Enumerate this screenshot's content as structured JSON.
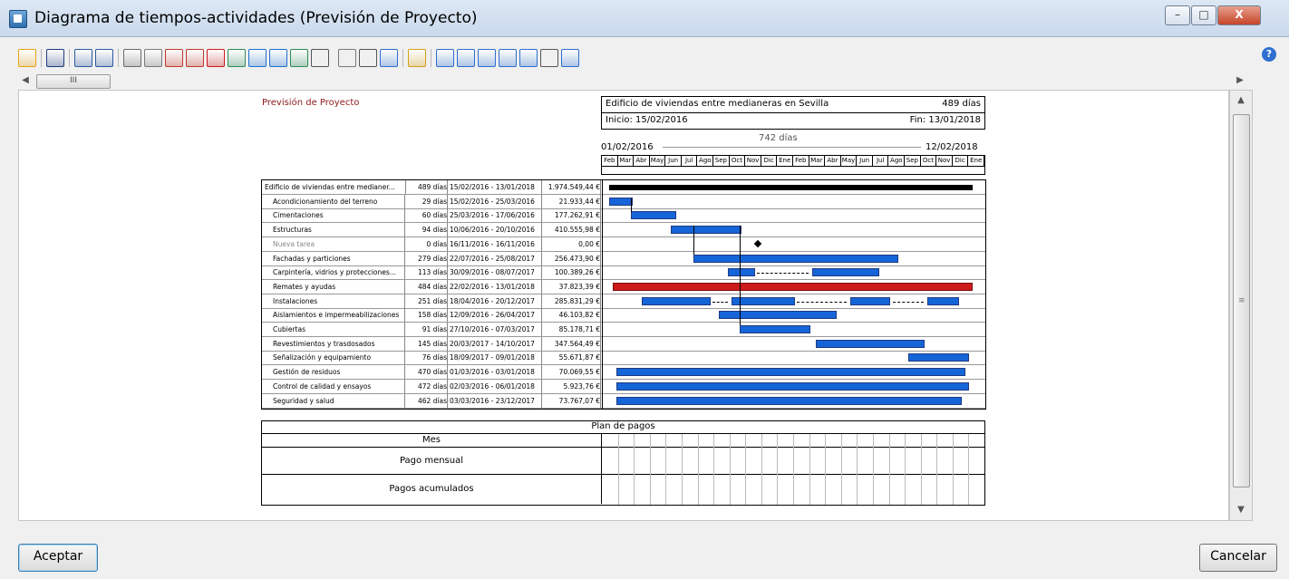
{
  "window": {
    "title": "Diagrama de tiempos-actividades (Previsión de Proyecto)",
    "minimize": "–",
    "maximize": "□",
    "close": "X"
  },
  "toolbar": {
    "icons": [
      "open-folder-icon",
      "save-icon",
      "undo-icon",
      "redo-icon",
      "properties-icon",
      "settings-icon",
      "people-icon",
      "person-icon",
      "delete-icon",
      "gantt-icon",
      "grid-icon",
      "link-icon",
      "chart-icon",
      "view-dropdown-icon",
      "copy-icon",
      "print-icon",
      "export-icon",
      "bar-chart-icon",
      "zoom-icon",
      "zoom-fit-icon",
      "zoom-in-icon",
      "refresh-icon",
      "zoom-out-icon",
      "hand-icon",
      "window-icon"
    ]
  },
  "report": {
    "header_title": "Previsión de Proyecto",
    "project_name": "Edificio de viviendas entre medianeras en Sevilla",
    "project_duration": "489 días",
    "start": "Inicio: 15/02/2016",
    "end": "Fin: 13/01/2018",
    "span": "742 días",
    "span_start": "01/02/2016",
    "span_end": "12/02/2018",
    "months": [
      "Feb",
      "Mar",
      "Abr",
      "May",
      "Jun",
      "Jul",
      "Ago",
      "Sep",
      "Oct",
      "Nov",
      "Dic",
      "Ene",
      "Feb",
      "Mar",
      "Abr",
      "May",
      "Jun",
      "Jul",
      "Ago",
      "Sep",
      "Oct",
      "Nov",
      "Dic",
      "Ene"
    ]
  },
  "tasks": [
    {
      "name": "Edificio de viviendas entre medianer...",
      "dur": "489 días",
      "dates": "15/02/2016 - 13/01/2018",
      "cost": "1.974.549,44 €",
      "start": 0.02,
      "end": 0.965,
      "color": "#000000",
      "summary": true
    },
    {
      "name": "Acondicionamiento del terreno",
      "dur": "29 días",
      "dates": "15/02/2016 - 25/03/2016",
      "cost": "21.933,44 €",
      "start": 0.02,
      "end": 0.076,
      "color": "#1565d8"
    },
    {
      "name": "Cimentaciones",
      "dur": "60 días",
      "dates": "25/03/2016 - 17/06/2016",
      "cost": "177.262,91 €",
      "start": 0.076,
      "end": 0.19,
      "color": "#1565d8"
    },
    {
      "name": "Estructuras",
      "dur": "94 días",
      "dates": "10/06/2016 - 20/10/2016",
      "cost": "410.555,98 €",
      "start": 0.18,
      "end": 0.36,
      "color": "#1565d8"
    },
    {
      "name": "Nueva tarea",
      "dur": "0 días",
      "dates": "16/11/2016 - 16/11/2016",
      "cost": "0,00 €",
      "start": 0.4,
      "end": 0.4,
      "color": "#000000",
      "milestone": true,
      "grey": true
    },
    {
      "name": "Fachadas y particiones",
      "dur": "279 días",
      "dates": "22/07/2016 - 25/08/2017",
      "cost": "256.473,90 €",
      "start": 0.24,
      "end": 0.77,
      "color": "#1565d8"
    },
    {
      "name": "Carpintería, vidrios y protecciones...",
      "dur": "113 días",
      "dates": "30/09/2016 - 08/07/2017",
      "cost": "100.389,26 €",
      "start": 0.33,
      "end": 0.72,
      "color": "#1565d8",
      "split": [
        [
          0.33,
          0.395
        ],
        [
          0.55,
          0.72
        ]
      ]
    },
    {
      "name": "Remates y ayudas",
      "dur": "484 días",
      "dates": "22/02/2016 - 13/01/2018",
      "cost": "37.823,39 €",
      "start": 0.028,
      "end": 0.965,
      "color": "#cc1a1a"
    },
    {
      "name": "Instalaciones",
      "dur": "251 días",
      "dates": "18/04/2016 - 20/12/2017",
      "cost": "285.831,29 €",
      "start": 0.105,
      "end": 0.93,
      "color": "#1565d8",
      "split": [
        [
          0.105,
          0.28
        ],
        [
          0.34,
          0.5
        ],
        [
          0.65,
          0.75
        ],
        [
          0.85,
          0.93
        ]
      ]
    },
    {
      "name": "Aislamientos e impermeabilizaciones",
      "dur": "158 días",
      "dates": "12/09/2016 - 26/04/2017",
      "cost": "46.103,82 €",
      "start": 0.305,
      "end": 0.61,
      "color": "#1565d8"
    },
    {
      "name": "Cubiertas",
      "dur": "91 días",
      "dates": "27/10/2016 - 07/03/2017",
      "cost": "85.178,71 €",
      "start": 0.36,
      "end": 0.54,
      "color": "#1565d8"
    },
    {
      "name": "Revestimientos y trasdosados",
      "dur": "145 días",
      "dates": "20/03/2017 - 14/10/2017",
      "cost": "347.564,49 €",
      "start": 0.56,
      "end": 0.84,
      "color": "#1565d8"
    },
    {
      "name": "Señalización y equipamiento",
      "dur": "76 días",
      "dates": "18/09/2017 - 09/01/2018",
      "cost": "55.671,87 €",
      "start": 0.8,
      "end": 0.955,
      "color": "#1565d8"
    },
    {
      "name": "Gestión de residuos",
      "dur": "470 días",
      "dates": "01/03/2016 - 03/01/2018",
      "cost": "70.069,55 €",
      "start": 0.038,
      "end": 0.945,
      "color": "#1565d8"
    },
    {
      "name": "Control de calidad y ensayos",
      "dur": "472 días",
      "dates": "02/03/2016 - 06/01/2018",
      "cost": "5.923,76 €",
      "start": 0.038,
      "end": 0.955,
      "color": "#1565d8"
    },
    {
      "name": "Seguridad y salud",
      "dur": "462 días",
      "dates": "03/03/2016 - 23/12/2017",
      "cost": "73.767,07 €",
      "start": 0.038,
      "end": 0.935,
      "color": "#1565d8"
    }
  ],
  "payments": {
    "title": "Plan de pagos",
    "month_label": "Mes",
    "monthly_label": "Pago mensual",
    "cumulative_label": "Pagos acumulados"
  },
  "buttons": {
    "accept": "Aceptar",
    "cancel": "Cancelar"
  }
}
